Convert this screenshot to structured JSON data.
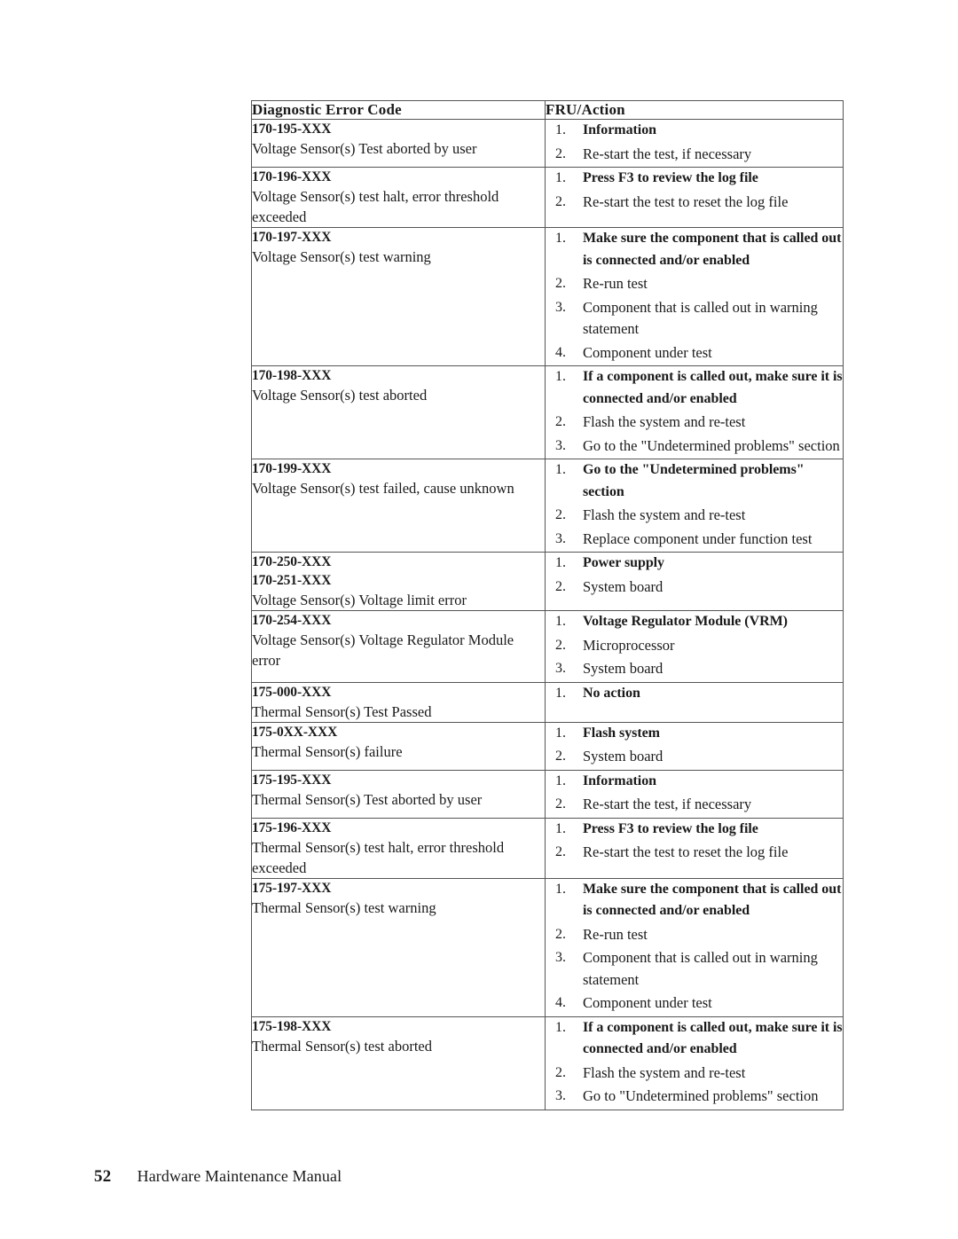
{
  "page": {
    "number": "52",
    "footer_title": "Hardware Maintenance Manual"
  },
  "table": {
    "headers": {
      "col1": "Diagnostic Error Code",
      "col2": "FRU/Action"
    },
    "rows": [
      {
        "code": "170-195-XXX",
        "description": "Voltage Sensor(s) Test aborted by user",
        "actions": [
          "Information",
          "Re-start the test, if necessary"
        ]
      },
      {
        "code": "170-196-XXX",
        "description": "Voltage Sensor(s) test halt, error threshold exceeded",
        "actions": [
          "Press F3 to review the log file",
          "Re-start the test to reset the log file"
        ]
      },
      {
        "code": "170-197-XXX",
        "description": "Voltage Sensor(s) test warning",
        "actions": [
          "Make sure the component that is called out is connected and/or enabled",
          "Re-run test",
          "Component that is called out in warning statement",
          "Component under test"
        ]
      },
      {
        "code": "170-198-XXX",
        "description": "Voltage Sensor(s) test aborted",
        "actions": [
          "If a component is called out, make sure it is connected and/or enabled",
          "Flash the system and re-test",
          "Go to the \"Undetermined problems\" section"
        ]
      },
      {
        "code": "170-199-XXX",
        "description": "Voltage Sensor(s) test failed, cause unknown",
        "actions": [
          "Go to the \"Undetermined problems\" section",
          "Flash the system and re-test",
          "Replace component under function test"
        ]
      },
      {
        "code": "170-250-XXX",
        "code2": "170-251-XXX",
        "description": "Voltage Sensor(s) Voltage limit error",
        "actions": [
          "Power supply",
          "System board"
        ]
      },
      {
        "code": "170-254-XXX",
        "description": "Voltage Sensor(s) Voltage Regulator Module error",
        "actions": [
          "Voltage Regulator Module (VRM)",
          "Microprocessor",
          "System board"
        ]
      },
      {
        "code": "175-000-XXX",
        "description": "Thermal Sensor(s) Test Passed",
        "actions": [
          "No action"
        ]
      },
      {
        "code": "175-0XX-XXX",
        "description": "Thermal Sensor(s) failure",
        "actions": [
          "Flash system",
          "System board"
        ]
      },
      {
        "code": "175-195-XXX",
        "description": "Thermal Sensor(s) Test aborted by user",
        "actions": [
          "Information",
          "Re-start the test, if necessary"
        ]
      },
      {
        "code": "175-196-XXX",
        "description": "Thermal Sensor(s) test halt, error threshold exceeded",
        "actions": [
          "Press F3 to review the log file",
          "Re-start the test to reset the log file"
        ]
      },
      {
        "code": "175-197-XXX",
        "description": "Thermal Sensor(s) test warning",
        "actions": [
          "Make sure the component that is called out is connected and/or enabled",
          "Re-run test",
          "Component that is called out in warning statement",
          "Component under test"
        ]
      },
      {
        "code": "175-198-XXX",
        "description": "Thermal Sensor(s) test aborted",
        "actions": [
          "If a component is called out, make sure it is connected and/or enabled",
          "Flash the system and re-test",
          "Go to \"Undetermined problems\" section"
        ]
      }
    ]
  }
}
